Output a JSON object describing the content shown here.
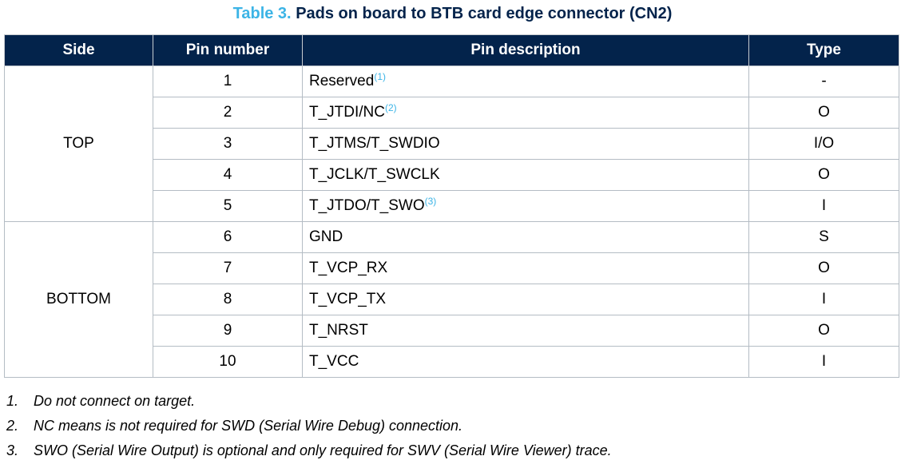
{
  "caption": {
    "number": "Table 3.",
    "title": "Pads on board to BTB card edge connector (CN2)"
  },
  "headers": {
    "side": "Side",
    "pin": "Pin number",
    "desc": "Pin description",
    "type": "Type"
  },
  "groups": [
    {
      "side": "TOP",
      "rows": [
        {
          "pin": "1",
          "desc": "Reserved",
          "note": "(1)",
          "type": "-"
        },
        {
          "pin": "2",
          "desc": "T_JTDI/NC",
          "note": "(2)",
          "type": "O"
        },
        {
          "pin": "3",
          "desc": "T_JTMS/T_SWDIO",
          "note": "",
          "type": "I/O"
        },
        {
          "pin": "4",
          "desc": "T_JCLK/T_SWCLK",
          "note": "",
          "type": "O"
        },
        {
          "pin": "5",
          "desc": "T_JTDO/T_SWO",
          "note": "(3)",
          "type": "I"
        }
      ]
    },
    {
      "side": "BOTTOM",
      "rows": [
        {
          "pin": "6",
          "desc": "GND",
          "note": "",
          "type": "S"
        },
        {
          "pin": "7",
          "desc": "T_VCP_RX",
          "note": "",
          "type": "O"
        },
        {
          "pin": "8",
          "desc": "T_VCP_TX",
          "note": "",
          "type": "I"
        },
        {
          "pin": "9",
          "desc": "T_NRST",
          "note": "",
          "type": "O"
        },
        {
          "pin": "10",
          "desc": "T_VCC",
          "note": "",
          "type": "I"
        }
      ]
    }
  ],
  "footnotes": [
    {
      "num": "1.",
      "text": "Do not connect on target."
    },
    {
      "num": "2.",
      "text": "NC means is not required for SWD (Serial Wire Debug) connection."
    },
    {
      "num": "3.",
      "text": "SWO (Serial Wire Output) is optional and only required for SWV (Serial Wire Viewer) trace."
    }
  ],
  "colors": {
    "header_bg": "#03234b",
    "accent": "#3cb4e6",
    "border": "#b4bcc4"
  }
}
